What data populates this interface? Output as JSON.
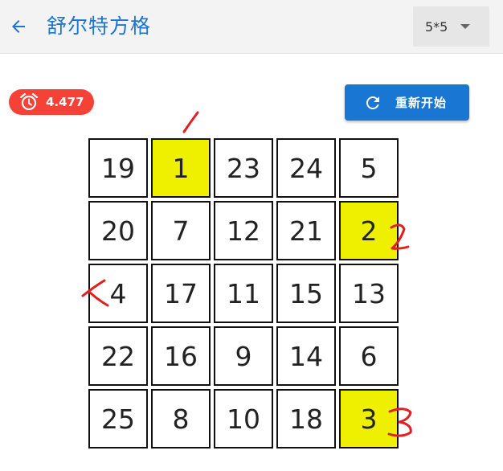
{
  "app": {
    "title": "舒尔特方格",
    "back_icon": "arrow-left-icon"
  },
  "size_select": {
    "value": "5*5",
    "icon": "caret-down-icon"
  },
  "timer": {
    "value": "4.477",
    "icon": "alarm-clock-icon"
  },
  "restart_button": {
    "label": "重新开始",
    "icon": "refresh-icon"
  },
  "grid": {
    "rows": 5,
    "cols": 5,
    "cells": [
      {
        "n": "19",
        "hit": false
      },
      {
        "n": "1",
        "hit": true
      },
      {
        "n": "23",
        "hit": false
      },
      {
        "n": "24",
        "hit": false
      },
      {
        "n": "5",
        "hit": false
      },
      {
        "n": "20",
        "hit": false
      },
      {
        "n": "7",
        "hit": false
      },
      {
        "n": "12",
        "hit": false
      },
      {
        "n": "21",
        "hit": false
      },
      {
        "n": "2",
        "hit": true
      },
      {
        "n": "4",
        "hit": false
      },
      {
        "n": "17",
        "hit": false
      },
      {
        "n": "11",
        "hit": false
      },
      {
        "n": "15",
        "hit": false
      },
      {
        "n": "13",
        "hit": false
      },
      {
        "n": "22",
        "hit": false
      },
      {
        "n": "16",
        "hit": false
      },
      {
        "n": "9",
        "hit": false
      },
      {
        "n": "14",
        "hit": false
      },
      {
        "n": "6",
        "hit": false
      },
      {
        "n": "25",
        "hit": false
      },
      {
        "n": "8",
        "hit": false
      },
      {
        "n": "10",
        "hit": false
      },
      {
        "n": "18",
        "hit": false
      },
      {
        "n": "3",
        "hit": true
      }
    ]
  },
  "annotations": {
    "color": "#e02020",
    "marks": [
      "1",
      "2",
      "3",
      "4"
    ]
  },
  "colors": {
    "primary": "#1976d2",
    "timer_bg": "#f44336",
    "highlight": "#eef000",
    "appbar_bg": "#f3f3f3"
  }
}
